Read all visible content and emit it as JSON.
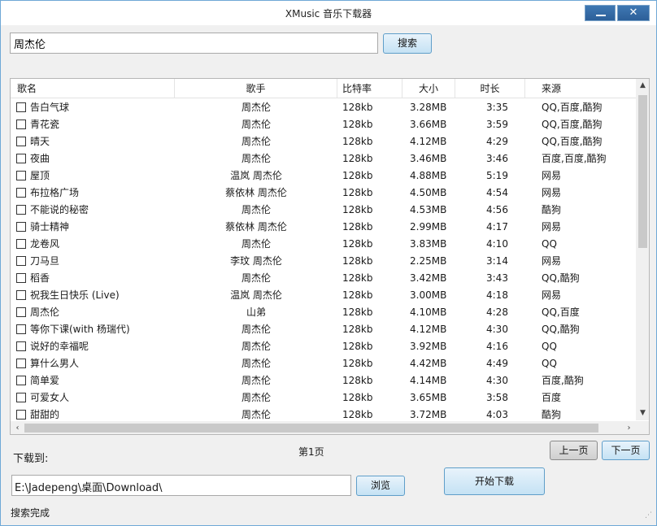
{
  "window": {
    "title": "XMusic 音乐下载器",
    "minimize_label": "",
    "close_label": "✕"
  },
  "search": {
    "query": "周杰伦",
    "button_label": "搜索"
  },
  "table": {
    "columns": {
      "name": "歌名",
      "singer": "歌手",
      "bitrate": "比特率",
      "size": "大小",
      "duration": "时长",
      "source": "来源"
    },
    "rows": [
      {
        "name": "告白气球",
        "singer": "周杰伦",
        "bitrate": "128kb",
        "size": "3.28MB",
        "duration": "3:35",
        "source": "QQ,百度,酷狗"
      },
      {
        "name": "青花瓷",
        "singer": "周杰伦",
        "bitrate": "128kb",
        "size": "3.66MB",
        "duration": "3:59",
        "source": "QQ,百度,酷狗"
      },
      {
        "name": "晴天",
        "singer": "周杰伦",
        "bitrate": "128kb",
        "size": "4.12MB",
        "duration": "4:29",
        "source": "QQ,百度,酷狗"
      },
      {
        "name": "夜曲",
        "singer": "周杰伦",
        "bitrate": "128kb",
        "size": "3.46MB",
        "duration": "3:46",
        "source": "百度,百度,酷狗"
      },
      {
        "name": "屋顶",
        "singer": "温岚 周杰伦",
        "bitrate": "128kb",
        "size": "4.88MB",
        "duration": "5:19",
        "source": "网易"
      },
      {
        "name": "布拉格广场",
        "singer": "蔡依林 周杰伦",
        "bitrate": "128kb",
        "size": "4.50MB",
        "duration": "4:54",
        "source": "网易"
      },
      {
        "name": "不能说的秘密",
        "singer": "周杰伦",
        "bitrate": "128kb",
        "size": "4.53MB",
        "duration": "4:56",
        "source": "酷狗"
      },
      {
        "name": "骑士精神",
        "singer": "蔡依林 周杰伦",
        "bitrate": "128kb",
        "size": "2.99MB",
        "duration": "4:17",
        "source": "网易"
      },
      {
        "name": "龙卷风",
        "singer": "周杰伦",
        "bitrate": "128kb",
        "size": "3.83MB",
        "duration": "4:10",
        "source": "QQ"
      },
      {
        "name": "刀马旦",
        "singer": "李玟 周杰伦",
        "bitrate": "128kb",
        "size": "2.25MB",
        "duration": "3:14",
        "source": "网易"
      },
      {
        "name": "稻香",
        "singer": "周杰伦",
        "bitrate": "128kb",
        "size": "3.42MB",
        "duration": "3:43",
        "source": "QQ,酷狗"
      },
      {
        "name": "祝我生日快乐 (Live)",
        "singer": "温岚 周杰伦",
        "bitrate": "128kb",
        "size": "3.00MB",
        "duration": "4:18",
        "source": "网易"
      },
      {
        "name": "周杰伦",
        "singer": "山弟",
        "bitrate": "128kb",
        "size": "4.10MB",
        "duration": "4:28",
        "source": "QQ,百度"
      },
      {
        "name": "等你下课(with 杨瑞代)",
        "singer": "周杰伦",
        "bitrate": "128kb",
        "size": "4.12MB",
        "duration": "4:30",
        "source": "QQ,酷狗"
      },
      {
        "name": "说好的幸福呢",
        "singer": "周杰伦",
        "bitrate": "128kb",
        "size": "3.92MB",
        "duration": "4:16",
        "source": "QQ"
      },
      {
        "name": "算什么男人",
        "singer": "周杰伦",
        "bitrate": "128kb",
        "size": "4.42MB",
        "duration": "4:49",
        "source": "QQ"
      },
      {
        "name": "简单爱",
        "singer": "周杰伦",
        "bitrate": "128kb",
        "size": "4.14MB",
        "duration": "4:30",
        "source": "百度,酷狗"
      },
      {
        "name": "可爱女人",
        "singer": "周杰伦",
        "bitrate": "128kb",
        "size": "3.65MB",
        "duration": "3:58",
        "source": "百度"
      },
      {
        "name": "甜甜的",
        "singer": "周杰伦",
        "bitrate": "128kb",
        "size": "3.72MB",
        "duration": "4:03",
        "source": "酷狗"
      }
    ]
  },
  "download": {
    "label": "下载到:",
    "path": "E:\\Jadepeng\\桌面\\Download\\",
    "browse_label": "浏览",
    "start_label": "开始下载"
  },
  "pagination": {
    "current_page": "第1页",
    "prev_label": "上一页",
    "next_label": "下一页"
  },
  "status": {
    "text": "搜索完成"
  }
}
